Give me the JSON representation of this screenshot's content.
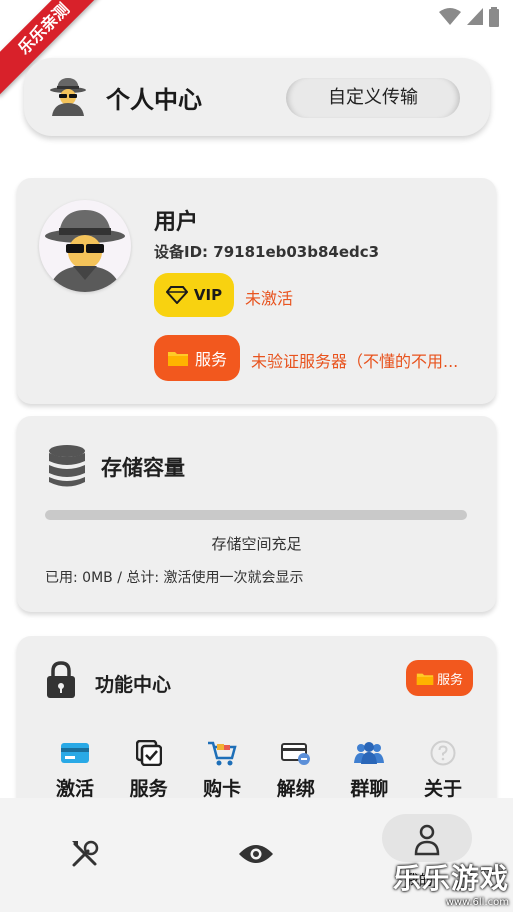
{
  "watermark": {
    "ribbon": "乐乐亲测",
    "corner_big": "乐乐游戏",
    "corner_small": "www.6ll.com"
  },
  "header": {
    "title": "个人中心",
    "custom_button": "自定义传输"
  },
  "user": {
    "name": "用户",
    "device_id": "设备ID: 79181eb03b84edc3",
    "vip_label": "VIP",
    "vip_status": "未激活",
    "service_label": "服务",
    "service_status": "未验证服务器（不懂的不用..."
  },
  "storage": {
    "title": "存储容量",
    "status": "存储空间充足",
    "usage": "已用: 0MB / 总计: 激活使用一次就会显示",
    "used_fraction": 0
  },
  "functions": {
    "title": "功能中心",
    "badge": "服务",
    "items": [
      {
        "label": "激活",
        "icon": "credit-card-icon"
      },
      {
        "label": "服务",
        "icon": "checkbox-stack-icon"
      },
      {
        "label": "购卡",
        "icon": "shopping-cart-icon"
      },
      {
        "label": "解绑",
        "icon": "card-unbind-icon"
      },
      {
        "label": "群聊",
        "icon": "group-icon"
      },
      {
        "label": "关于",
        "icon": "help-circle-icon"
      }
    ]
  },
  "nav": {
    "active_label": "我的"
  },
  "colors": {
    "accent_orange": "#f2581e",
    "vip_yellow": "#f8d210",
    "card_bg": "#efefef"
  }
}
